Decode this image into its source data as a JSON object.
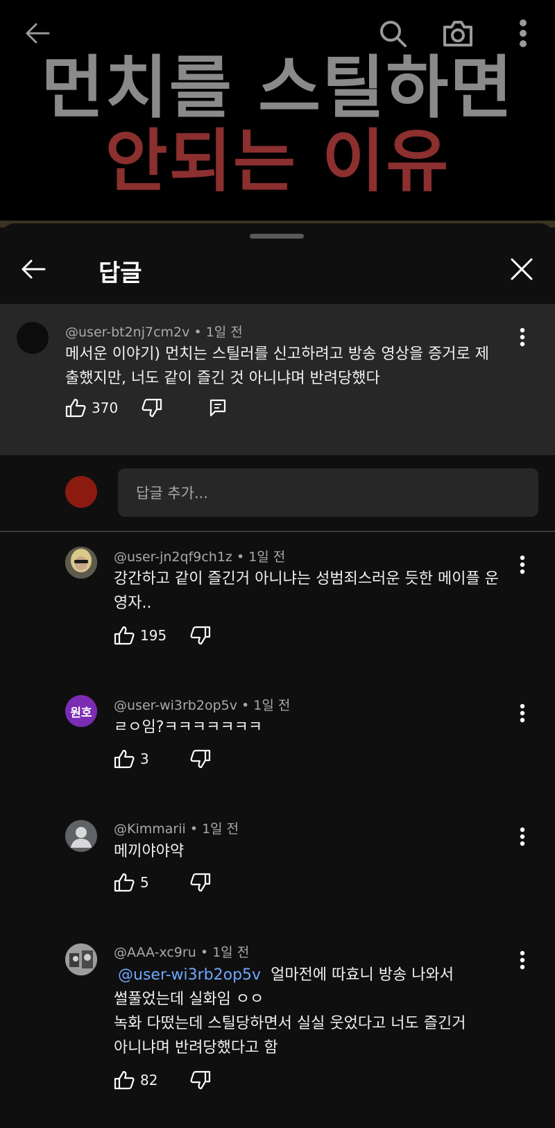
{
  "video": {
    "title_line1": "먼치를 스틸하면",
    "title_line2": "안되는 이유"
  },
  "icons": {
    "back": "arrow-left-icon",
    "search": "search-icon",
    "camera": "camera-icon",
    "more": "more-vertical-icon",
    "close": "close-icon",
    "like": "thumbs-up-icon",
    "dislike": "thumbs-down-icon",
    "reply": "reply-icon"
  },
  "header": {
    "title": "답글"
  },
  "parent_comment": {
    "author": "@user-bt2nj7cm2v",
    "time": "1일 전",
    "text": "메서운 이야기) 먼치는 스틸러를 신고하려고 방송 영상을 증거로 제출했지만, 너도 같이 즐긴 것 아니냐며 반려당했다",
    "likes": "370"
  },
  "reply_input": {
    "placeholder": "답글 추가..."
  },
  "replies": [
    {
      "author": "@user-jn2qf9ch1z",
      "time": "1일 전",
      "text": "강간하고 같이 즐긴거 아니냐는 성범죄스러운 듯한 메이플 운영자..",
      "likes": "195"
    },
    {
      "author": "@user-wi3rb2op5v",
      "time": "1일 전",
      "avatar_text": "원호",
      "text": "ㄹㅇ임?ㅋㅋㅋㅋㅋㅋㅋ",
      "likes": "3"
    },
    {
      "author": "@Kimmarii",
      "time": "1일 전",
      "text": "메끼야야약",
      "likes": "5"
    },
    {
      "author": "@AAA-xc9ru",
      "time": "1일 전",
      "mention": "@user-wi3rb2op5v",
      "text_line1": "얼마전에 따효니 방송 나와서",
      "text_line2": "썰풀었는데 실화임 ㅇㅇ",
      "text_line3": "녹화 다떴는데 스틸당하면서 실실 웃었다고 너도 즐긴거",
      "text_line4": "아니냐며 반려당했다고 함",
      "likes": "82"
    }
  ],
  "colors": {
    "background": "#0f0f0f",
    "parent_bg": "#272727",
    "title_gray": "#8a8a8a",
    "title_red": "#8b2f2f",
    "mention_blue": "#6fa8ff",
    "avatar_purple": "#7b2cb3"
  }
}
